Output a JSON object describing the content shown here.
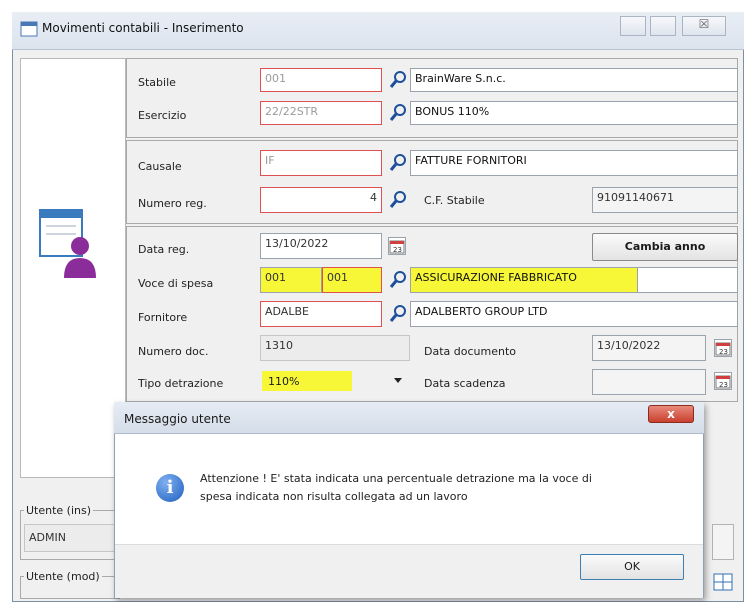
{
  "window": {
    "title": "Movimenti contabili - Inserimento",
    "close_symbol": "☒"
  },
  "header": {
    "stabile_label": "Stabile",
    "stabile_code": "001",
    "stabile_name": "BrainWare S.n.c.",
    "esercizio_label": "Esercizio",
    "esercizio_code": "22/22STR",
    "esercizio_name": "BONUS 110%"
  },
  "registration": {
    "causale_label": "Causale",
    "causale_code": "IF",
    "causale_name": "FATTURE FORNITORI",
    "numero_label": "Numero reg.",
    "numero_value": "4",
    "cf_label": "C.F. Stabile",
    "cf_value": "91091140671"
  },
  "detail": {
    "data_reg_label": "Data reg.",
    "data_reg_value": "13/10/2022",
    "cambia_anno_label": "Cambia anno",
    "voce_label": "Voce di spesa",
    "voce_code1": "001",
    "voce_code2": "001",
    "voce_name": "ASSICURAZIONE FABBRICATO",
    "fornitore_label": "Fornitore",
    "fornitore_code": "ADALBE",
    "fornitore_name": "ADALBERTO GROUP LTD",
    "numero_doc_label": "Numero doc.",
    "numero_doc_value": "1310",
    "data_doc_label": "Data documento",
    "data_doc_value": "13/10/2022",
    "tipo_detr_label": "Tipo detrazione",
    "tipo_detr_value": "110%",
    "data_scad_label": "Data scadenza",
    "data_scad_value": ""
  },
  "users": {
    "ins_label": "Utente (ins)",
    "ins_value": "ADMIN",
    "mod_label": "Utente (mod)"
  },
  "dialog": {
    "title": "Messaggio utente",
    "message_line1": "Attenzione ! E' stata indicata una percentuale detrazione ma la voce di",
    "message_line2": "spesa indicata non risulta collegata ad un lavoro",
    "ok_label": "OK",
    "info_symbol": "i",
    "close_symbol": "x"
  },
  "colors": {
    "highlight": "#f7f738",
    "required_border": "#e05050",
    "info_blue": "#1f5fbf"
  },
  "icons": [
    "window-icon",
    "user-calendar-icon",
    "search-icon",
    "calendar-icon",
    "dropdown-arrow-icon",
    "info-icon",
    "close-icon",
    "grid-icon"
  ]
}
